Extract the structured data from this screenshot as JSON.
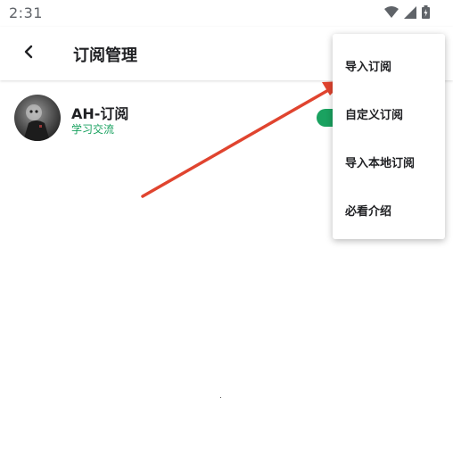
{
  "status_bar": {
    "time": "2:31",
    "icons": [
      "wifi-icon",
      "signal-icon",
      "battery-icon"
    ]
  },
  "app_bar": {
    "back_icon": "back-arrow-icon",
    "title": "订阅管理"
  },
  "subscriptions": [
    {
      "name": "AH-订阅",
      "subtitle": "学习交流",
      "enabled": true
    }
  ],
  "overflow_menu": {
    "items": [
      {
        "label": "导入订阅"
      },
      {
        "label": "自定义订阅"
      },
      {
        "label": "导入本地订阅"
      },
      {
        "label": "必看介绍"
      }
    ]
  },
  "colors": {
    "accent_green": "#1aa260",
    "annotation_arrow": "#e0442f"
  }
}
